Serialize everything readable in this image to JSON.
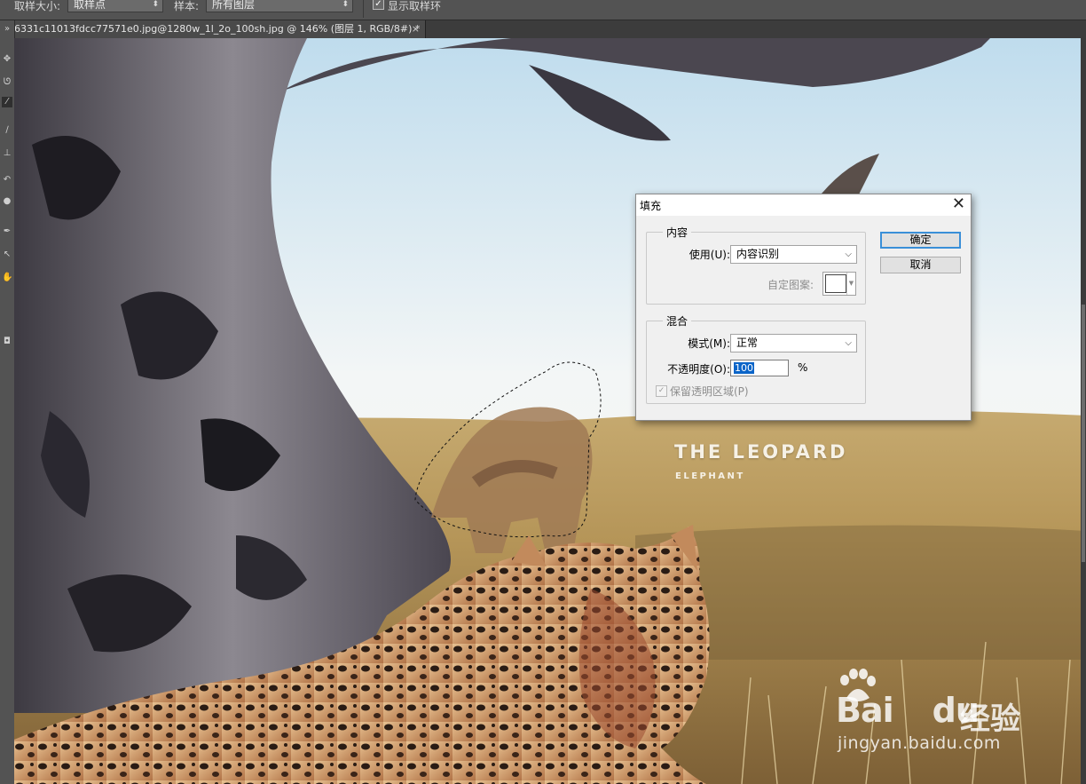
{
  "options_bar": {
    "sample_size_label": "取样大小:",
    "sample_size_value": "取样点",
    "sample_label": "样本:",
    "sample_value": "所有图层",
    "show_ring_label": "显示取样环",
    "show_ring_checked": true
  },
  "document_tab": {
    "title": "6331c11013fdcc77571e0.jpg@1280w_1l_2o_100sh.jpg @ 146% (图层 1, RGB/8#) *",
    "close": "×"
  },
  "canvas": {
    "poster_title": "THE LEOPARD",
    "poster_subtitle": "ELEPHANT"
  },
  "watermark": {
    "logo_a": "Bai",
    "logo_b": "du",
    "chinese": "经验",
    "url": "jingyan.baidu.com"
  },
  "fill_dialog": {
    "title": "填充",
    "close": "✕",
    "contents_group": "内容",
    "use_label": "使用(U):",
    "use_value": "内容识别",
    "custom_pattern_label": "自定图案:",
    "blending_group": "混合",
    "mode_label": "模式(M):",
    "mode_value": "正常",
    "opacity_label": "不透明度(O):",
    "opacity_value": "100",
    "opacity_unit": "%",
    "preserve_transparency_label": "保留透明区域(P)",
    "preserve_transparency_checked": true,
    "preserve_transparency_enabled": false,
    "ok_label": "确定",
    "cancel_label": "取消"
  },
  "colors": {
    "accent_focus": "#3a8fd8",
    "selection_highlight": "#0a64c8",
    "ui_dark": "#535353"
  }
}
